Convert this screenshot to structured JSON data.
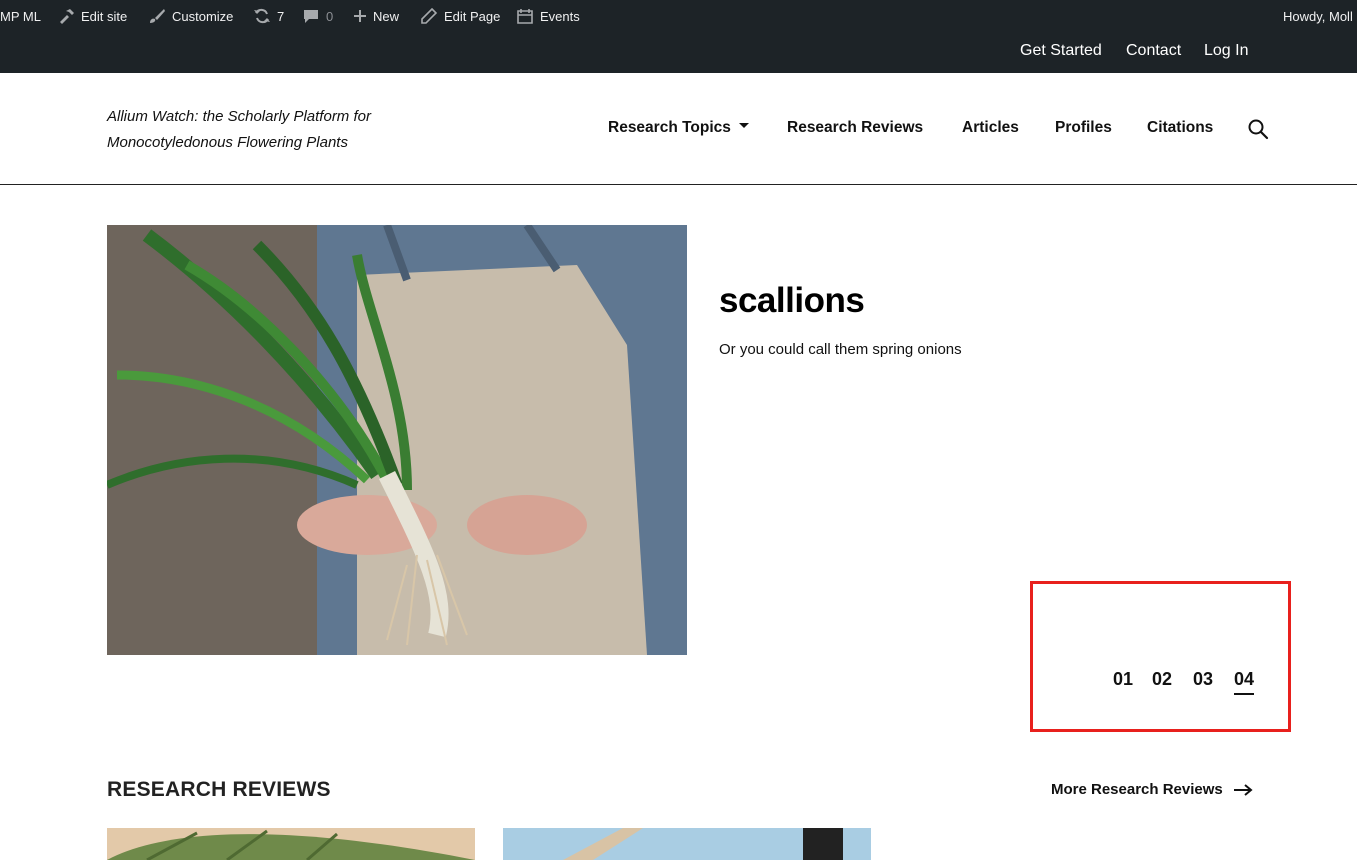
{
  "admin_bar": {
    "site_label": "MP ML",
    "edit_site": "Edit site",
    "customize": "Customize",
    "updates_count": "7",
    "comments_count": "0",
    "new_label": "New",
    "edit_page": "Edit Page",
    "events": "Events",
    "greeting": "Howdy, Moll"
  },
  "top_nav": [
    "Get Started",
    "Contact",
    "Log In"
  ],
  "header": {
    "site_title": "Allium Watch: the Scholarly Platform for Monocotyledonous Flowering Plants",
    "nav": [
      "Research Topics",
      "Research Reviews",
      "Articles",
      "Profiles",
      "Citations"
    ]
  },
  "hero": {
    "title": "scallions",
    "subtitle": "Or you could call them spring onions",
    "pages": [
      "01",
      "02",
      "03",
      "04"
    ],
    "active_page": "04"
  },
  "section": {
    "heading": "RESEARCH REVIEWS",
    "more_link": "More Research Reviews"
  },
  "colors": {
    "admin_bar_bg": "#1d2327",
    "highlight": "#e8201d"
  }
}
